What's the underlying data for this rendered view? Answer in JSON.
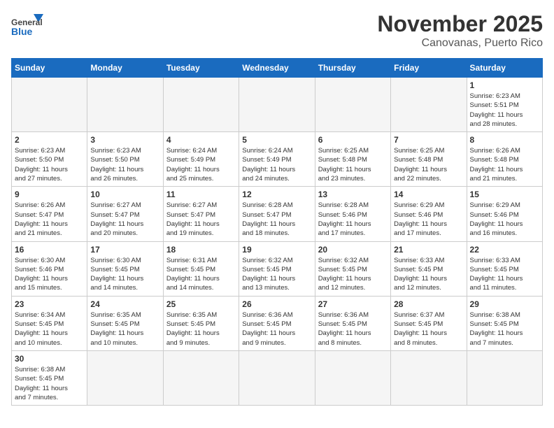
{
  "header": {
    "logo_text_general": "General",
    "logo_text_blue": "Blue",
    "month_title": "November 2025",
    "location": "Canovanas, Puerto Rico"
  },
  "weekdays": [
    "Sunday",
    "Monday",
    "Tuesday",
    "Wednesday",
    "Thursday",
    "Friday",
    "Saturday"
  ],
  "weeks": [
    [
      {
        "day": "",
        "info": ""
      },
      {
        "day": "",
        "info": ""
      },
      {
        "day": "",
        "info": ""
      },
      {
        "day": "",
        "info": ""
      },
      {
        "day": "",
        "info": ""
      },
      {
        "day": "",
        "info": ""
      },
      {
        "day": "1",
        "info": "Sunrise: 6:23 AM\nSunset: 5:51 PM\nDaylight: 11 hours\nand 28 minutes."
      }
    ],
    [
      {
        "day": "2",
        "info": "Sunrise: 6:23 AM\nSunset: 5:50 PM\nDaylight: 11 hours\nand 27 minutes."
      },
      {
        "day": "3",
        "info": "Sunrise: 6:23 AM\nSunset: 5:50 PM\nDaylight: 11 hours\nand 26 minutes."
      },
      {
        "day": "4",
        "info": "Sunrise: 6:24 AM\nSunset: 5:49 PM\nDaylight: 11 hours\nand 25 minutes."
      },
      {
        "day": "5",
        "info": "Sunrise: 6:24 AM\nSunset: 5:49 PM\nDaylight: 11 hours\nand 24 minutes."
      },
      {
        "day": "6",
        "info": "Sunrise: 6:25 AM\nSunset: 5:48 PM\nDaylight: 11 hours\nand 23 minutes."
      },
      {
        "day": "7",
        "info": "Sunrise: 6:25 AM\nSunset: 5:48 PM\nDaylight: 11 hours\nand 22 minutes."
      },
      {
        "day": "8",
        "info": "Sunrise: 6:26 AM\nSunset: 5:48 PM\nDaylight: 11 hours\nand 21 minutes."
      }
    ],
    [
      {
        "day": "9",
        "info": "Sunrise: 6:26 AM\nSunset: 5:47 PM\nDaylight: 11 hours\nand 21 minutes."
      },
      {
        "day": "10",
        "info": "Sunrise: 6:27 AM\nSunset: 5:47 PM\nDaylight: 11 hours\nand 20 minutes."
      },
      {
        "day": "11",
        "info": "Sunrise: 6:27 AM\nSunset: 5:47 PM\nDaylight: 11 hours\nand 19 minutes."
      },
      {
        "day": "12",
        "info": "Sunrise: 6:28 AM\nSunset: 5:47 PM\nDaylight: 11 hours\nand 18 minutes."
      },
      {
        "day": "13",
        "info": "Sunrise: 6:28 AM\nSunset: 5:46 PM\nDaylight: 11 hours\nand 17 minutes."
      },
      {
        "day": "14",
        "info": "Sunrise: 6:29 AM\nSunset: 5:46 PM\nDaylight: 11 hours\nand 17 minutes."
      },
      {
        "day": "15",
        "info": "Sunrise: 6:29 AM\nSunset: 5:46 PM\nDaylight: 11 hours\nand 16 minutes."
      }
    ],
    [
      {
        "day": "16",
        "info": "Sunrise: 6:30 AM\nSunset: 5:46 PM\nDaylight: 11 hours\nand 15 minutes."
      },
      {
        "day": "17",
        "info": "Sunrise: 6:30 AM\nSunset: 5:45 PM\nDaylight: 11 hours\nand 14 minutes."
      },
      {
        "day": "18",
        "info": "Sunrise: 6:31 AM\nSunset: 5:45 PM\nDaylight: 11 hours\nand 14 minutes."
      },
      {
        "day": "19",
        "info": "Sunrise: 6:32 AM\nSunset: 5:45 PM\nDaylight: 11 hours\nand 13 minutes."
      },
      {
        "day": "20",
        "info": "Sunrise: 6:32 AM\nSunset: 5:45 PM\nDaylight: 11 hours\nand 12 minutes."
      },
      {
        "day": "21",
        "info": "Sunrise: 6:33 AM\nSunset: 5:45 PM\nDaylight: 11 hours\nand 12 minutes."
      },
      {
        "day": "22",
        "info": "Sunrise: 6:33 AM\nSunset: 5:45 PM\nDaylight: 11 hours\nand 11 minutes."
      }
    ],
    [
      {
        "day": "23",
        "info": "Sunrise: 6:34 AM\nSunset: 5:45 PM\nDaylight: 11 hours\nand 10 minutes."
      },
      {
        "day": "24",
        "info": "Sunrise: 6:35 AM\nSunset: 5:45 PM\nDaylight: 11 hours\nand 10 minutes."
      },
      {
        "day": "25",
        "info": "Sunrise: 6:35 AM\nSunset: 5:45 PM\nDaylight: 11 hours\nand 9 minutes."
      },
      {
        "day": "26",
        "info": "Sunrise: 6:36 AM\nSunset: 5:45 PM\nDaylight: 11 hours\nand 9 minutes."
      },
      {
        "day": "27",
        "info": "Sunrise: 6:36 AM\nSunset: 5:45 PM\nDaylight: 11 hours\nand 8 minutes."
      },
      {
        "day": "28",
        "info": "Sunrise: 6:37 AM\nSunset: 5:45 PM\nDaylight: 11 hours\nand 8 minutes."
      },
      {
        "day": "29",
        "info": "Sunrise: 6:38 AM\nSunset: 5:45 PM\nDaylight: 11 hours\nand 7 minutes."
      }
    ],
    [
      {
        "day": "30",
        "info": "Sunrise: 6:38 AM\nSunset: 5:45 PM\nDaylight: 11 hours\nand 7 minutes."
      },
      {
        "day": "",
        "info": ""
      },
      {
        "day": "",
        "info": ""
      },
      {
        "day": "",
        "info": ""
      },
      {
        "day": "",
        "info": ""
      },
      {
        "day": "",
        "info": ""
      },
      {
        "day": "",
        "info": ""
      }
    ]
  ]
}
